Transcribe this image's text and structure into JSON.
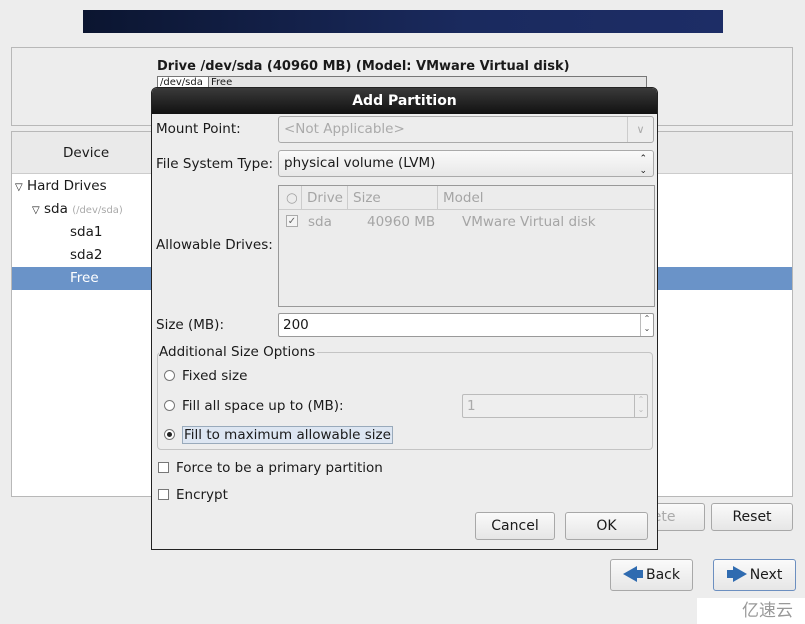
{
  "drive": {
    "title": "Drive /dev/sda (40960 MB) (Model: VMware Virtual disk)",
    "bar_segments": [
      "/dev/sda",
      "Free"
    ]
  },
  "tree": {
    "header": "Device",
    "items": [
      {
        "label": "Hard Drives"
      },
      {
        "label": "sda",
        "sub": "(/dev/sda)"
      },
      {
        "label": "sda1"
      },
      {
        "label": "sda2"
      },
      {
        "label": "Free",
        "selected": true
      }
    ]
  },
  "buttons": {
    "delete": "Delete",
    "reset": "Reset",
    "back": "Back",
    "next": "Next"
  },
  "dialog": {
    "title": "Add Partition",
    "mount_point_label": "Mount Point:",
    "mount_point_value": "<Not Applicable>",
    "fs_type_label": "File System Type:",
    "fs_type_value": "physical volume (LVM)",
    "allowable_label": "Allowable Drives:",
    "drives_columns": [
      "Drive",
      "Size",
      "Model"
    ],
    "drives_rows": [
      {
        "checked": true,
        "drive": "sda",
        "size": "40960 MB",
        "model": "VMware Virtual disk"
      }
    ],
    "size_label": "Size (MB):",
    "size_value": "200",
    "size_options_title": "Additional Size Options",
    "opt_fixed": "Fixed size",
    "opt_fill_upto": "Fill all space up to (MB):",
    "fill_upto_value": "1",
    "opt_fill_max": "Fill to maximum allowable size",
    "selected_option": "Fill to maximum allowable size",
    "force_primary": "Force to be a primary partition",
    "encrypt": "Encrypt",
    "cancel": "Cancel",
    "ok": "OK"
  },
  "watermark": "亿速云",
  "colors": {
    "selection": "#6a93c8",
    "arrow": "#2f6bb0"
  }
}
